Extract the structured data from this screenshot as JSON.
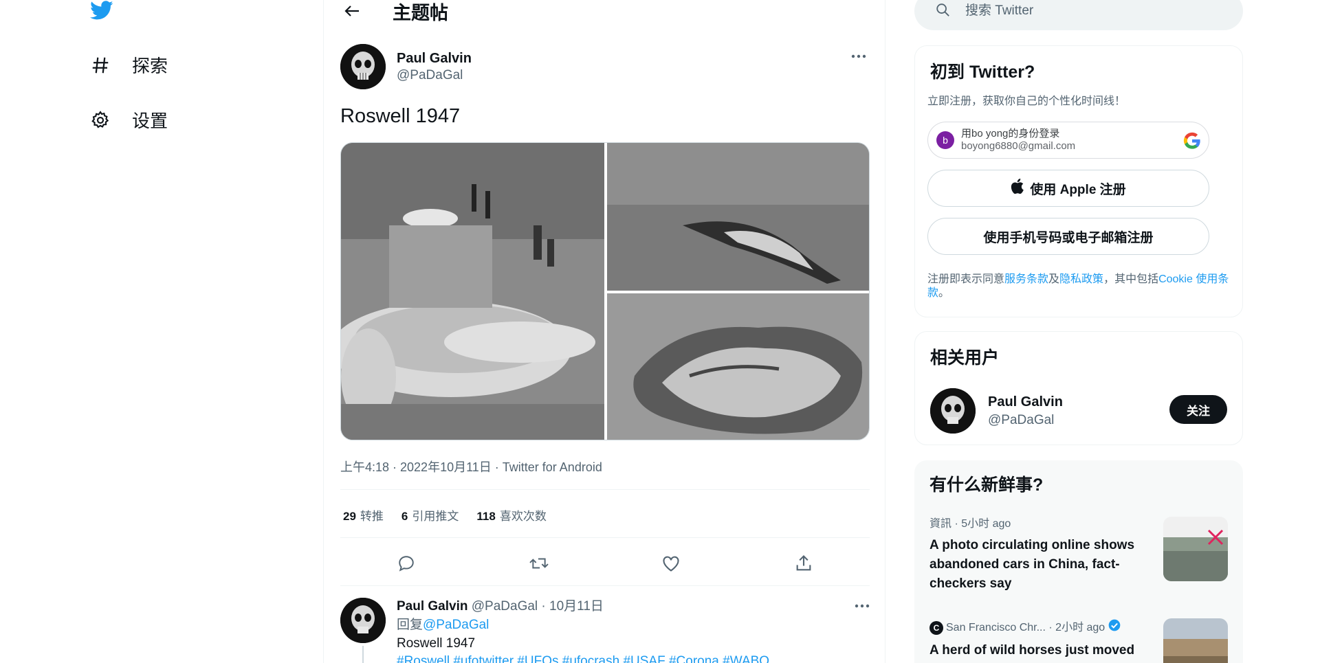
{
  "nav": {
    "explore_label": "探索",
    "settings_label": "设置"
  },
  "thread": {
    "title": "主题帖"
  },
  "tweet": {
    "author_name": "Paul Galvin",
    "author_handle": "@PaDaGal",
    "text": "Roswell 1947",
    "meta": "上午4:18 · 2022年10月11日 · Twitter for Android",
    "stats": {
      "retweets_count": "29",
      "retweets_label": "转推",
      "quotes_count": "6",
      "quotes_label": "引用推文",
      "likes_count": "118",
      "likes_label": "喜欢次数"
    }
  },
  "reply": {
    "author_name": "Paul Galvin",
    "author_handle_date": "@PaDaGal · 10月11日",
    "reply_to_prefix": "回复",
    "reply_to_handle": "@PaDaGal",
    "text": "Roswell 1947",
    "hashtags": "#Roswell #ufotwitter #UFOs #ufocrash #USAF #Corona #WABO"
  },
  "search": {
    "placeholder": "搜索 Twitter"
  },
  "signup": {
    "title": "初到 Twitter?",
    "subtitle": "立即注册，获取你自己的个性化时间线！",
    "google_avatar_letter": "b",
    "google_line1": "用bo yong的身份登录",
    "google_line2": "boyong6880@gmail.com",
    "apple_label": "使用 Apple 注册",
    "phone_label": "使用手机号码或电子邮箱注册",
    "legal_prefix": "注册即表示同意",
    "legal_terms": "服务条款",
    "legal_and": "及",
    "legal_privacy": "隐私政策",
    "legal_mid": "，其中包括",
    "legal_cookie": "Cookie 使用条款",
    "legal_end": "。"
  },
  "related": {
    "title": "相关用户",
    "user_name": "Paul Galvin",
    "user_handle": "@PaDaGal",
    "follow_label": "关注"
  },
  "trends": {
    "title": "有什么新鲜事?",
    "items": [
      {
        "meta": "資訊 · 5小时 ago",
        "headline": "A photo circulating online shows abandoned cars in China, fact-checkers say"
      },
      {
        "source_letter": "C",
        "meta": "San Francisco Chr... · 2小时 ago",
        "headline": "A herd of wild horses just moved into this iconic California"
      }
    ]
  },
  "colors": {
    "accent": "#1d9bf0",
    "text": "#0f1419",
    "muted": "#536471"
  }
}
